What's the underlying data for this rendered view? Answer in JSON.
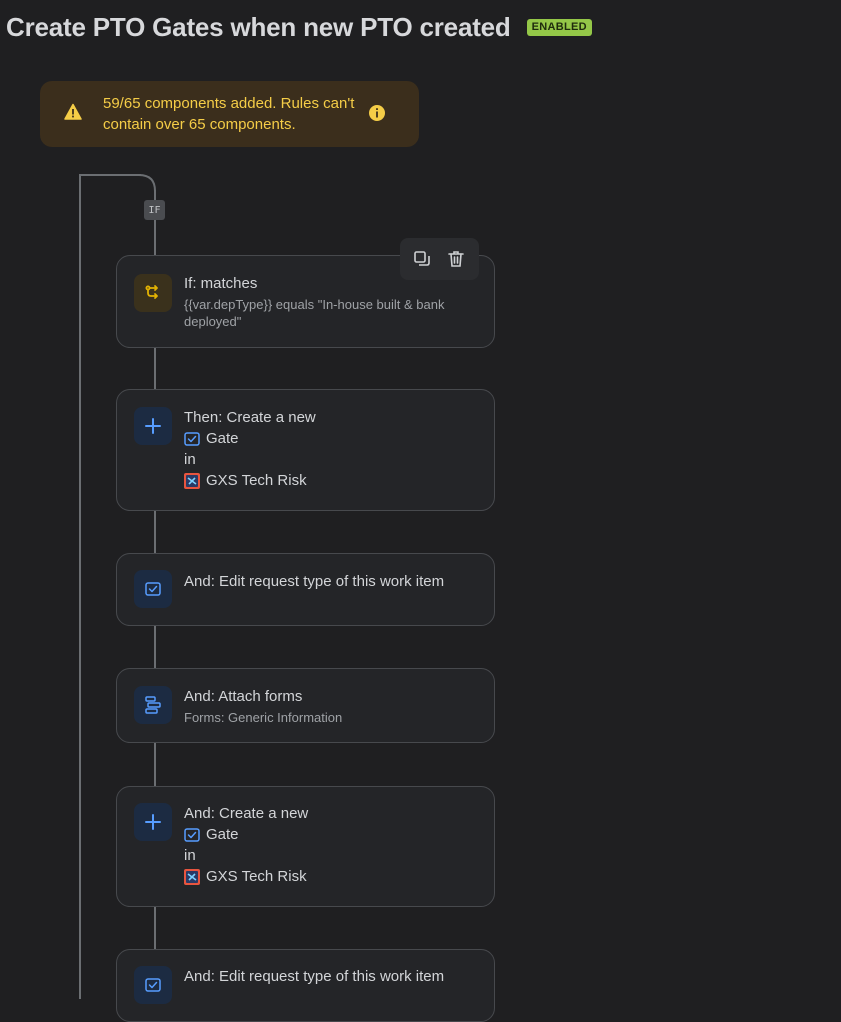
{
  "header": {
    "title": "Create PTO Gates when new PTO created",
    "status_badge": "ENABLED"
  },
  "warning": {
    "message": "59/65 components added. Rules can't contain over 65 components.",
    "icon": "warning-icon",
    "info_icon": "info-icon"
  },
  "branch": {
    "if_label": "IF"
  },
  "toolbar": {
    "duplicate_icon": "duplicate-icon",
    "delete_icon": "trash-icon"
  },
  "steps": [
    {
      "title": "If: matches",
      "subtitle": "{{var.depType}} equals \"In-house built & bank deployed\"",
      "icon": "branch-icon"
    },
    {
      "title": "Then: Create a new",
      "work_type": "Gate",
      "in_label": "in",
      "project": "GXS Tech Risk",
      "icon": "plus-icon"
    },
    {
      "title": "And: Edit request type of this work item",
      "icon": "request-type-icon"
    },
    {
      "title": "And: Attach forms",
      "subtitle": "Forms: Generic Information",
      "icon": "forms-icon"
    },
    {
      "title": "And: Create a new",
      "work_type": "Gate",
      "in_label": "in",
      "project": "GXS Tech Risk",
      "icon": "plus-icon"
    },
    {
      "title": "And: Edit request type of this work item",
      "icon": "request-type-icon"
    }
  ],
  "colors": {
    "accent": "#579dff",
    "warning_text": "#f5cd47",
    "badge_bg": "#94c748",
    "background": "#1f1f21"
  }
}
